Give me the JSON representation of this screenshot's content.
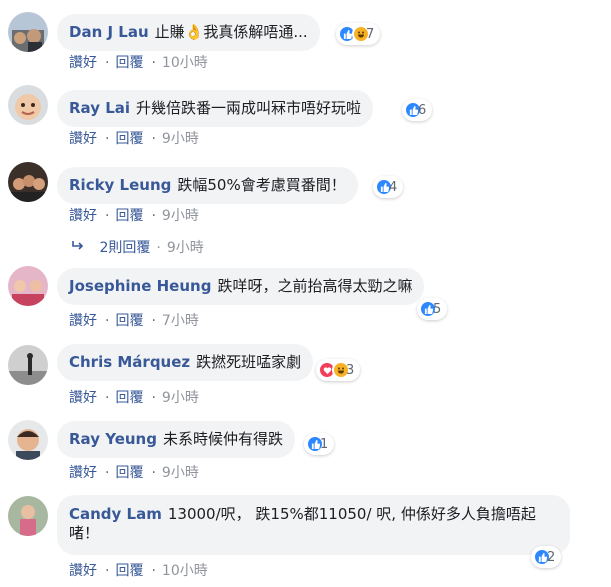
{
  "actions": {
    "like": "讚好",
    "reply": "回覆",
    "sep": "·"
  },
  "comments": [
    {
      "name": "Dan J Lau",
      "text": "止賺👌我真係解唔通...",
      "time": "10小時",
      "count": "7",
      "reactions": [
        "like",
        "haha"
      ]
    },
    {
      "name": "Ray Lai",
      "text": "升幾倍跌番一兩成叫冧市唔好玩啦",
      "time": "9小時",
      "count": "6",
      "reactions": [
        "like"
      ]
    },
    {
      "name": "Ricky Leung",
      "text": "跌幅50%會考慮買番間！",
      "time": "9小時",
      "count": "4",
      "reactions": [
        "like"
      ]
    },
    {
      "name": "Josephine Heung",
      "text": "跌咩呀，之前抬高得太勁之嘛",
      "time": "7小時",
      "count": "5",
      "reactions": [
        "like"
      ]
    },
    {
      "name": "Chris Márquez",
      "text": "跌撚死班𠵼家劇",
      "time": "9小時",
      "count": "3",
      "reactions": [
        "love",
        "haha"
      ]
    },
    {
      "name": "Ray Yeung",
      "text": "未系時候仲有得跌",
      "time": "9小時",
      "count": "1",
      "reactions": [
        "like"
      ]
    },
    {
      "name": "Candy Lam",
      "text": "13000/呎， 跌15%都11050/ 呎, 仲係好多人負擔唔起啫！",
      "time": "10小時",
      "count": "2",
      "reactions": [
        "like"
      ]
    }
  ],
  "replies": {
    "label": "2則回覆",
    "time": "9小時"
  },
  "colors": {
    "link": "#385898",
    "bubble": "#f2f3f5",
    "like": "#2d88ff",
    "haha": "#f7b125",
    "love": "#f33e58"
  }
}
